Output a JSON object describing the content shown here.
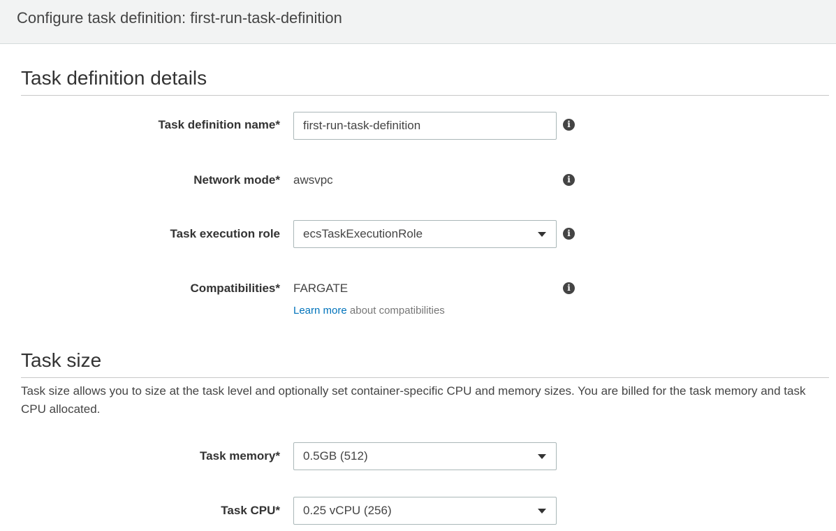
{
  "header": {
    "title": "Configure task definition: first-run-task-definition"
  },
  "details_section": {
    "title": "Task definition details",
    "name": {
      "label": "Task definition name*",
      "value": "first-run-task-definition"
    },
    "network_mode": {
      "label": "Network mode*",
      "value": "awsvpc"
    },
    "execution_role": {
      "label": "Task execution role",
      "value": "ecsTaskExecutionRole"
    },
    "compatibilities": {
      "label": "Compatibilities*",
      "value": "FARGATE",
      "help_link": "Learn more",
      "help_text": " about compatibilities"
    }
  },
  "size_section": {
    "title": "Task size",
    "description": "Task size allows you to size at the task level and optionally set container-specific CPU and memory sizes. You are billed for the task memory and task CPU allocated.",
    "memory": {
      "label": "Task memory*",
      "value": "0.5GB (512)"
    },
    "cpu": {
      "label": "Task CPU*",
      "value": "0.25 vCPU (256)"
    }
  },
  "icons": {
    "info": "i",
    "info_name": "info-icon",
    "caret_name": "caret-down-icon"
  },
  "colors": {
    "link": "#0073bb",
    "header_bg": "#f2f3f3",
    "border": "#aab7b8"
  }
}
